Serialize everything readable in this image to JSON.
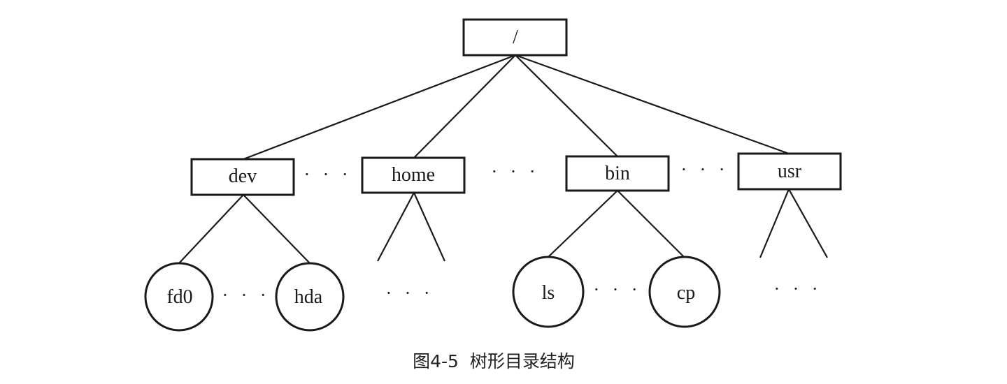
{
  "diagram": {
    "root": {
      "label": "/"
    },
    "directories": [
      {
        "label": "dev"
      },
      {
        "label": "home"
      },
      {
        "label": "bin"
      },
      {
        "label": "usr"
      }
    ],
    "dev_children": [
      {
        "label": "fd0"
      },
      {
        "label": "hda"
      }
    ],
    "bin_children": [
      {
        "label": "ls"
      },
      {
        "label": "cp"
      }
    ],
    "ellipsis": "· · ·",
    "caption": "图4-5  树形目录结构"
  }
}
